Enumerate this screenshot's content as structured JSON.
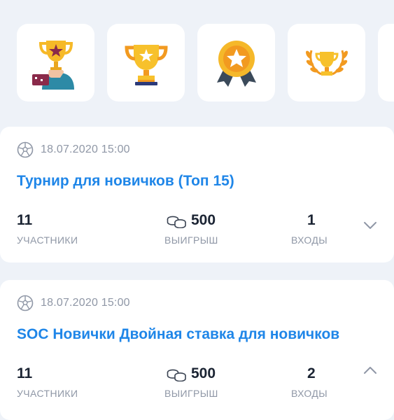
{
  "achievements": [
    {
      "icon": "trophy-hand-icon"
    },
    {
      "icon": "trophy-star-icon"
    },
    {
      "icon": "medal-ribbon-icon"
    },
    {
      "icon": "laurel-trophy-icon"
    },
    {
      "icon": "partial-badge-icon"
    }
  ],
  "tournaments": [
    {
      "date": "18.07.2020 15:00",
      "title": "Турнир для новичков (Топ 15)",
      "participants_value": "11",
      "participants_label": "УЧАСТНИКИ",
      "prize_value": "500",
      "prize_label": "ВЫИГРЫШ",
      "entries_value": "1",
      "entries_label": "ВХОДЫ",
      "expand_icon": "chevron-down-icon"
    },
    {
      "date": "18.07.2020 15:00",
      "title": "SOC Новички Двойная ставка для новичков",
      "participants_value": "11",
      "participants_label": "УЧАСТНИКИ",
      "prize_value": "500",
      "prize_label": "ВЫИГРЫШ",
      "entries_value": "2",
      "entries_label": "ВХОДЫ",
      "expand_icon": "chevron-up-icon"
    }
  ],
  "colors": {
    "accent": "#1f86e8",
    "text": "#1b2433",
    "muted": "#8f97a6",
    "background": "#eef2f8"
  }
}
